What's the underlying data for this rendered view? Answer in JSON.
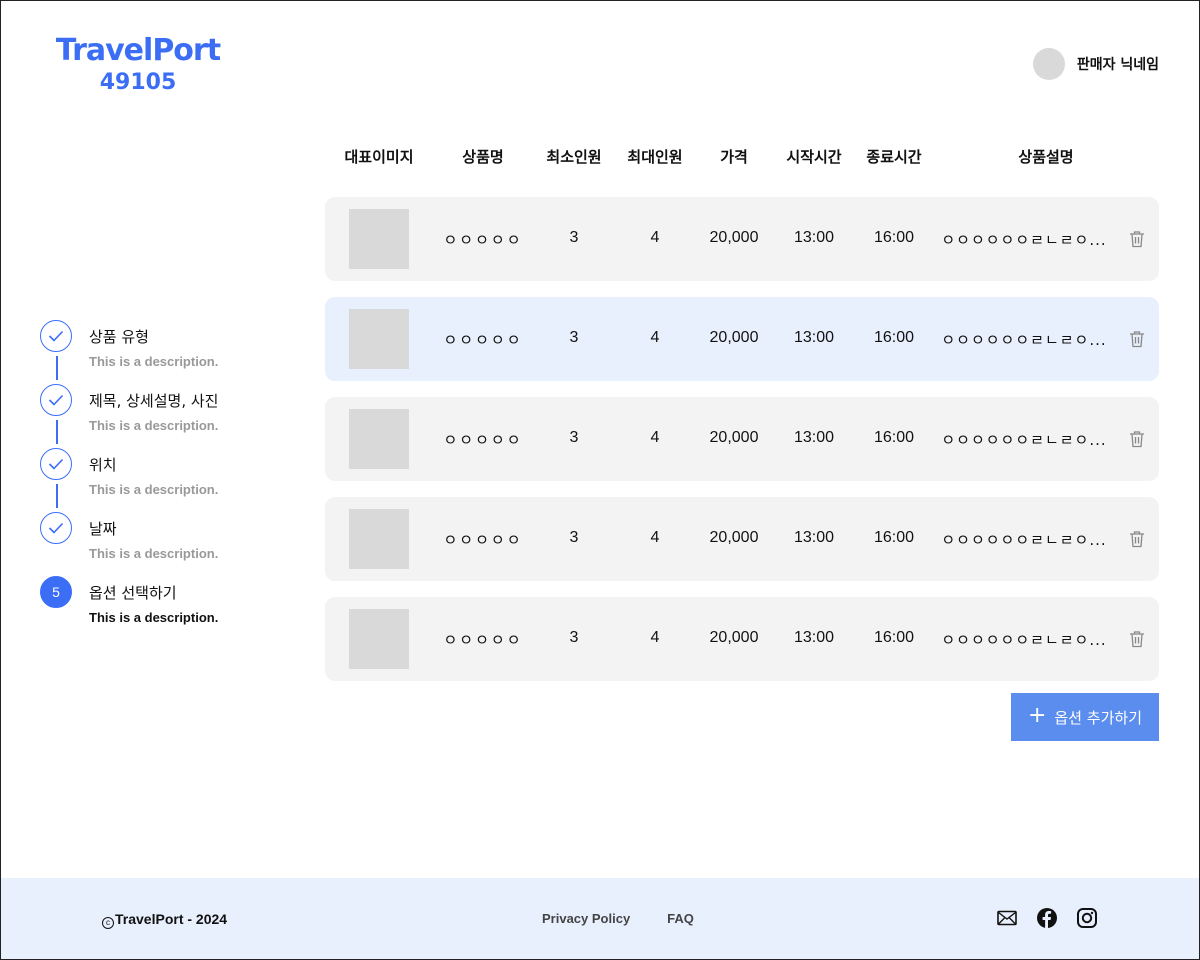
{
  "header": {
    "logo_title": "TravelPort",
    "logo_number": "49105",
    "user_name": "판매자 닉네임"
  },
  "stepper": {
    "steps": [
      {
        "title": "상품 유형",
        "description": "This is a description.",
        "state": "done"
      },
      {
        "title": "제목, 상세설명, 사진",
        "description": "This is a description.",
        "state": "done"
      },
      {
        "title": "위치",
        "description": "This is a description.",
        "state": "done"
      },
      {
        "title": "날짜",
        "description": "This is a description.",
        "state": "done"
      },
      {
        "title": "옵션 선택하기",
        "description": "This is a description.",
        "state": "current",
        "number": "5"
      }
    ]
  },
  "table": {
    "columns": [
      "대표이미지",
      "상품명",
      "최소인원",
      "최대인원",
      "가격",
      "시작시간",
      "종료시간",
      "상품설명"
    ],
    "rows": [
      {
        "name": "ㅇㅇㅇㅇㅇ",
        "min": "3",
        "max": "4",
        "price": "20,000",
        "start": "13:00",
        "end": "16:00",
        "desc": "ㅇㅇㅇㅇㅇㅇㄹㄴㄹㅇ...",
        "selected": false
      },
      {
        "name": "ㅇㅇㅇㅇㅇ",
        "min": "3",
        "max": "4",
        "price": "20,000",
        "start": "13:00",
        "end": "16:00",
        "desc": "ㅇㅇㅇㅇㅇㅇㄹㄴㄹㅇ...",
        "selected": true
      },
      {
        "name": "ㅇㅇㅇㅇㅇ",
        "min": "3",
        "max": "4",
        "price": "20,000",
        "start": "13:00",
        "end": "16:00",
        "desc": "ㅇㅇㅇㅇㅇㅇㄹㄴㄹㅇ...",
        "selected": false
      },
      {
        "name": "ㅇㅇㅇㅇㅇ",
        "min": "3",
        "max": "4",
        "price": "20,000",
        "start": "13:00",
        "end": "16:00",
        "desc": "ㅇㅇㅇㅇㅇㅇㄹㄴㄹㅇ...",
        "selected": false
      },
      {
        "name": "ㅇㅇㅇㅇㅇ",
        "min": "3",
        "max": "4",
        "price": "20,000",
        "start": "13:00",
        "end": "16:00",
        "desc": "ㅇㅇㅇㅇㅇㅇㄹㄴㄹㅇ...",
        "selected": false
      }
    ],
    "delete_icon": "trash-icon"
  },
  "add_option_button": {
    "label": "옵션 추가하기",
    "icon": "plus-icon"
  },
  "footer": {
    "copyright": "TravelPort - 2024",
    "copyright_symbol": "c",
    "links": [
      "Privacy Policy",
      "FAQ"
    ],
    "social_icons": [
      "mail-icon",
      "facebook-icon",
      "instagram-icon"
    ]
  },
  "colors": {
    "accent": "#3b6ef5",
    "button": "#5b8def",
    "selected_row": "#e8effd",
    "row": "#f3f3f3",
    "footer_bg": "#e8effd"
  }
}
